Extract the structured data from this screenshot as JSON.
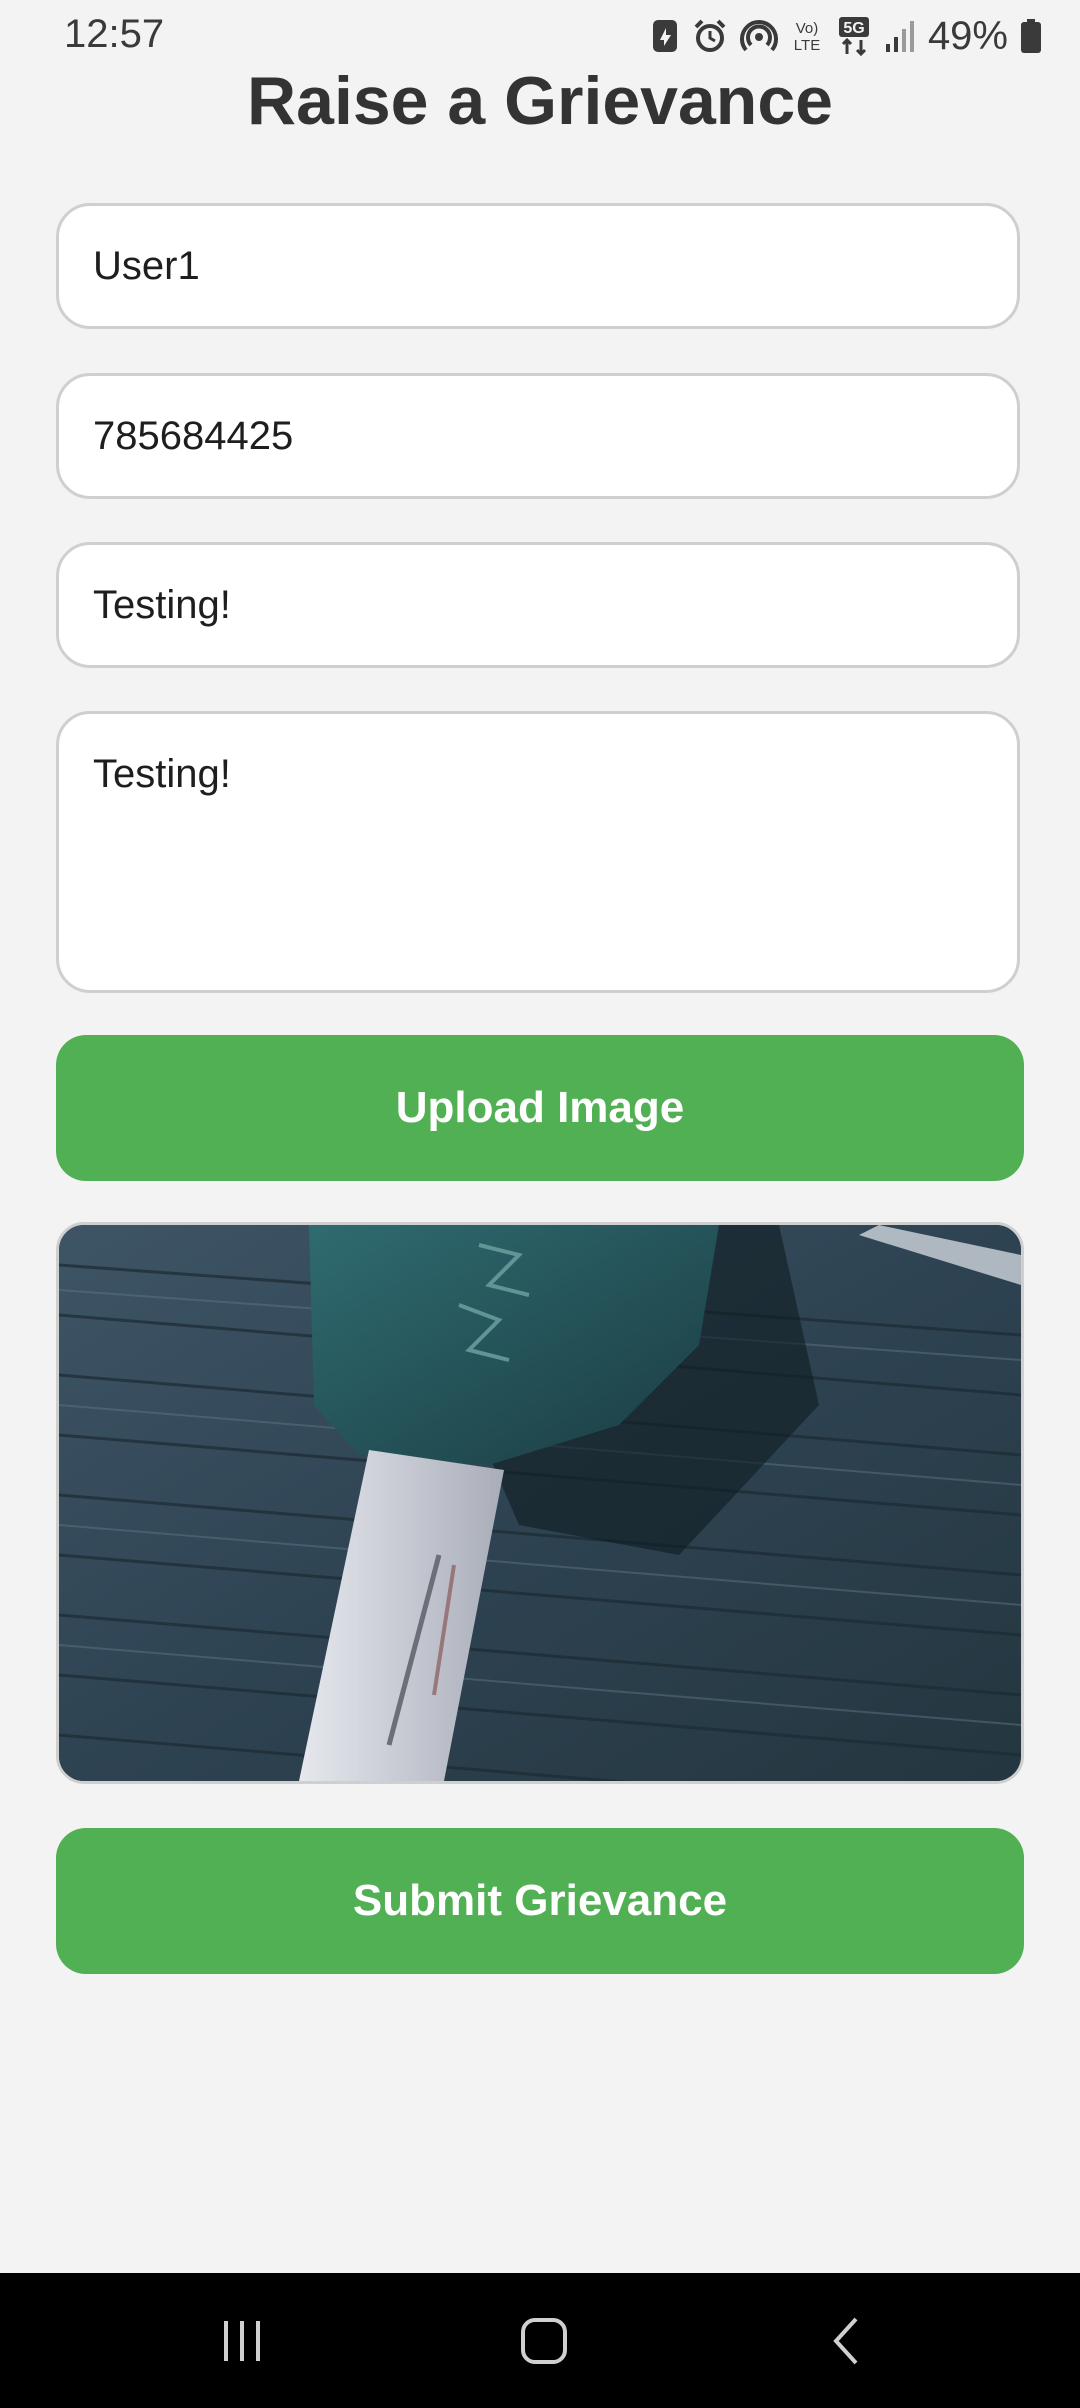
{
  "status_bar": {
    "time": "12:57",
    "battery": "49%",
    "icons": [
      "data-saver-icon",
      "alarm-icon",
      "hotspot-icon",
      "volte-icon",
      "5g-icon",
      "signal-icon",
      "battery-icon"
    ],
    "volte_label_top": "Vo)",
    "volte_label_bottom": "LTE",
    "network_label": "5G"
  },
  "page": {
    "title": "Raise a Grievance"
  },
  "form": {
    "name_value": "User1",
    "phone_value": "785684425",
    "subject_value": "Testing!",
    "description_value": "Testing!",
    "upload_label": "Upload Image",
    "submit_label": "Submit Grievance"
  },
  "preview": {
    "icon": "uploaded-image-preview"
  },
  "nav": {
    "icons": [
      "recents-icon",
      "home-icon",
      "back-icon"
    ]
  },
  "colors": {
    "accent": "#51b053",
    "background": "#f3f3f3",
    "nav_background": "#000000"
  }
}
